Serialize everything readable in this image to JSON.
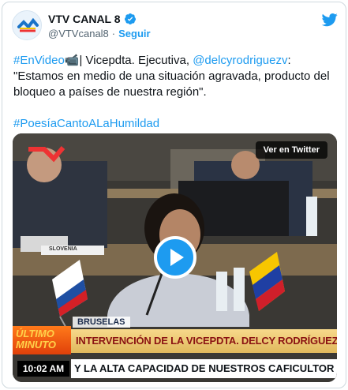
{
  "account": {
    "name": "VTV CANAL 8",
    "handle": "@VTVcanal8",
    "separator": "·",
    "follow_label": "Seguir"
  },
  "tweet": {
    "hashtag_video": "#EnVideo",
    "camera_emoji": "📹",
    "role_text": "| Vicepdta. Ejecutiva, ",
    "mention": "@delcyrodriguezv",
    "colon": ":",
    "quote": "\"Estamos en medio de una situación agravada, producto del bloqueo a países de nuestra región\".",
    "hashtag_poesia": "#PoesíaCantoALaHumildad"
  },
  "video": {
    "view_on_twitter": "Ver en Twitter",
    "location_label": "BRUSELAS",
    "headline": "INTERVENCIÓN DE LA VICEPDTA. DELCY RODRÍGUEZ EN LA CELAC-UE",
    "breaking_label": "ÚLTIMO MINUTO",
    "time": "10:02 AM",
    "ticker_text": "Y LA ALTA CAPACIDAD DE NUESTROS CAFICULTOR",
    "nameplate": "SLOVENIA"
  },
  "colors": {
    "link": "#1d9bf0",
    "twitter_blue": "#1d9bf0",
    "banner_orange": "#ff7a1a",
    "headline_red": "#8a1212"
  },
  "icons": {
    "verified": "verified-badge-icon",
    "brand": "twitter-bird-icon",
    "play": "play-icon"
  }
}
